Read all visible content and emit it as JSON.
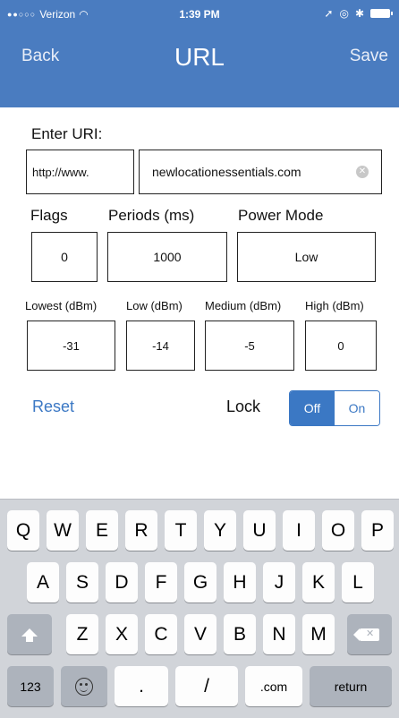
{
  "status_bar": {
    "carrier": "Verizon",
    "time": "1:39 PM"
  },
  "nav": {
    "back_label": "Back",
    "title": "URL",
    "save_label": "Save"
  },
  "uri": {
    "label": "Enter URI:",
    "prefix": "http://www.",
    "value": "newlocationessentials.com"
  },
  "fields": {
    "flags_label": "Flags",
    "flags_value": "0",
    "periods_label": "Periods (ms)",
    "periods_value": "1000",
    "power_label": "Power Mode",
    "power_value": "Low"
  },
  "power_levels": {
    "lowest_label": "Lowest (dBm)",
    "lowest_value": "-31",
    "low_label": "Low (dBm)",
    "low_value": "-14",
    "medium_label": "Medium (dBm)",
    "medium_value": "-5",
    "high_label": "High (dBm)",
    "high_value": "0"
  },
  "actions": {
    "reset_label": "Reset",
    "lock_label": "Lock",
    "lock_off": "Off",
    "lock_on": "On",
    "lock_selected": "Off"
  },
  "keyboard": {
    "row1": [
      "Q",
      "W",
      "E",
      "R",
      "T",
      "Y",
      "U",
      "I",
      "O",
      "P"
    ],
    "row2": [
      "A",
      "S",
      "D",
      "F",
      "G",
      "H",
      "J",
      "K",
      "L"
    ],
    "row3": [
      "Z",
      "X",
      "C",
      "V",
      "B",
      "N",
      "M"
    ],
    "key_123": "123",
    "key_dot": ".",
    "key_slash": "/",
    "key_com": ".com",
    "key_return": "return"
  },
  "colors": {
    "header": "#4a7cc0",
    "accent": "#3b78c4"
  }
}
